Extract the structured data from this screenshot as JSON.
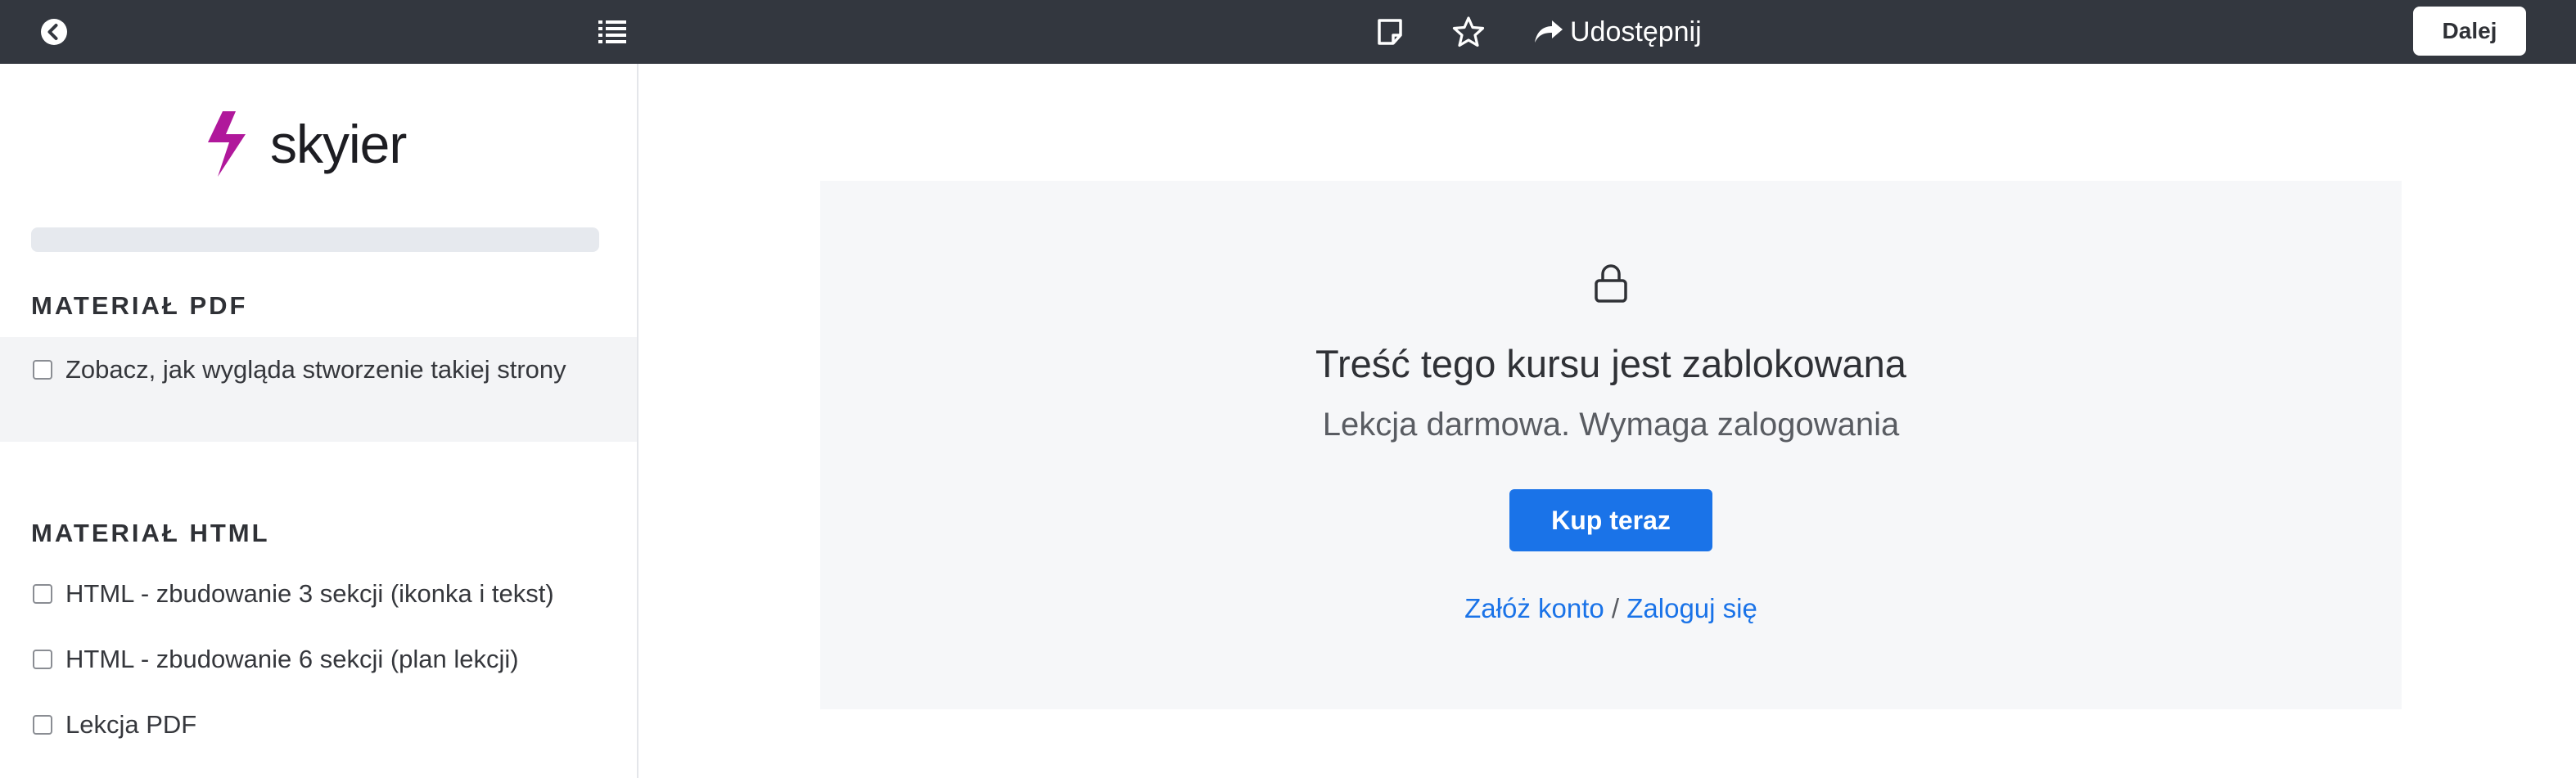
{
  "topbar": {
    "back_icon": "circle-chevron-left-icon",
    "list_icon": "list-icon",
    "note_icon": "sticky-note-icon",
    "star_icon": "star-outline-icon",
    "share_icon": "share-arrow-icon",
    "share_label": "Udostępnij",
    "next_label": "Dalej"
  },
  "sidebar": {
    "logo_text": "skyier",
    "progress_fraction": 0,
    "sections": [
      {
        "title": "MATERIAŁ PDF",
        "lessons": [
          {
            "label": "Zobacz, jak wygląda stworzenie takiej strony",
            "checked": false,
            "active": true
          }
        ]
      },
      {
        "title": "MATERIAŁ HTML",
        "lessons": [
          {
            "label": "HTML - zbudowanie 3 sekcji (ikonka i tekst)",
            "checked": false
          },
          {
            "label": "HTML - zbudowanie 6 sekcji (plan lekcji)",
            "checked": false
          },
          {
            "label": "Lekcja PDF",
            "checked": false
          }
        ]
      }
    ]
  },
  "main": {
    "lock_icon": "lock-icon",
    "title": "Treść tego kursu jest zablokowana",
    "subtitle": "Lekcja darmowa. Wymaga zalogowania",
    "buy_label": "Kup teraz",
    "signup_label": "Załóż konto",
    "separator": "/",
    "login_label": "Zaloguj się"
  },
  "colors": {
    "topbar": "#33373f",
    "accent": "#1a73e8",
    "panel": "#f6f7f9",
    "logo_bolt": "#b0189b"
  }
}
